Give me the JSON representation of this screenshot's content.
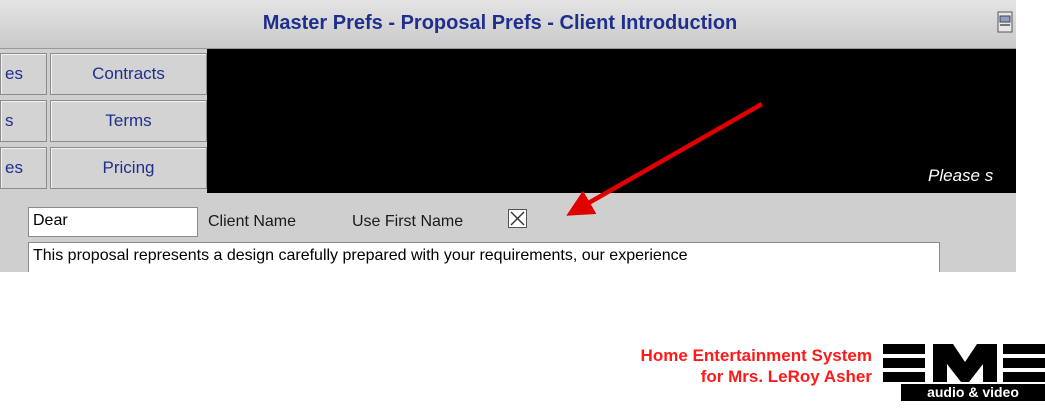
{
  "window": {
    "title": "Master Prefs - Proposal Prefs - Client Introduction"
  },
  "tabs": {
    "left_column": [
      "es",
      "s",
      "es"
    ],
    "right_column": [
      "Contracts",
      "Terms",
      "Pricing"
    ]
  },
  "panel": {
    "hint_text": "Please s"
  },
  "salutation": {
    "value": "Dear",
    "client_name_label": "Client Name",
    "use_first_name_label": "Use First Name",
    "use_first_name_checked": true
  },
  "intro_text": "This proposal represents a design carefully prepared with your requirements, our experience",
  "footer": {
    "line1": "Home Entertainment System",
    "line2": "for Mrs. LeRoy Asher",
    "logo_text": "audio & video",
    "colors": {
      "red": "#ff1a1a",
      "title_blue": "#1f2f8c"
    }
  }
}
